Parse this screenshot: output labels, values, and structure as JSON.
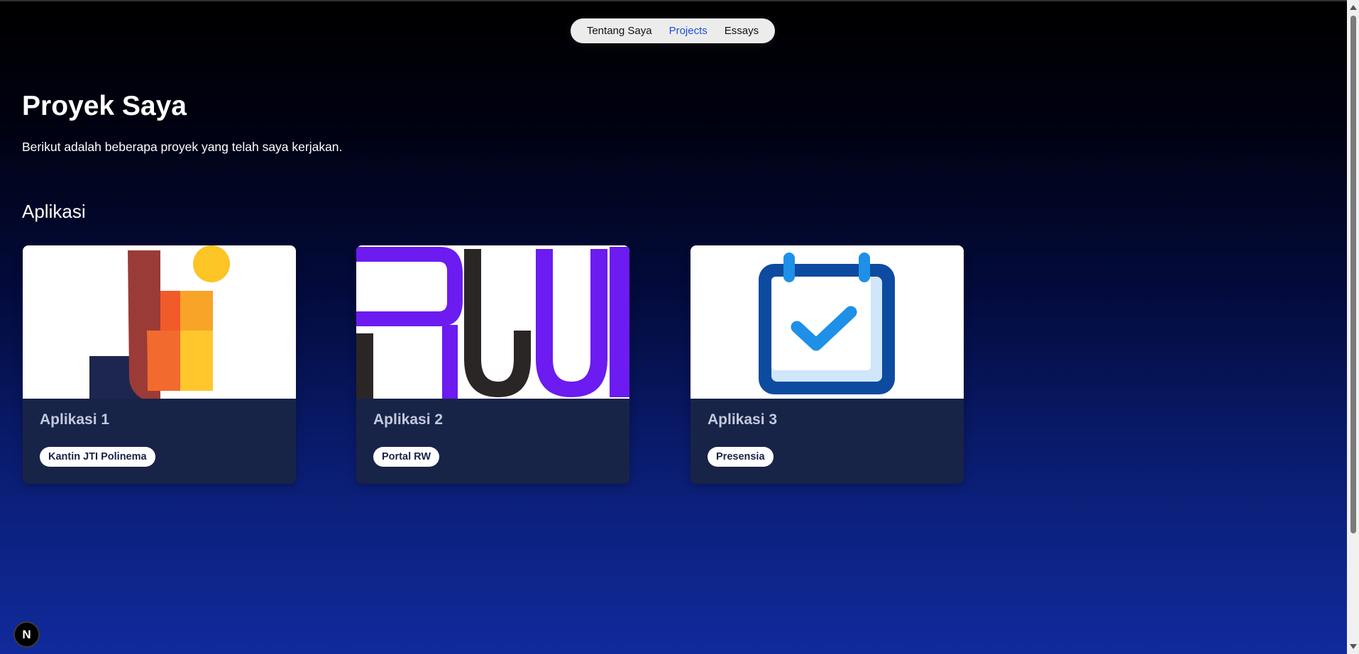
{
  "nav": {
    "items": [
      {
        "label": "Tentang Saya",
        "active": false
      },
      {
        "label": "Projects",
        "active": true
      },
      {
        "label": "Essays",
        "active": false
      }
    ],
    "active_color": "#1d4ed8"
  },
  "header": {
    "title": "Proyek Saya",
    "subtitle": "Berikut adalah beberapa proyek yang telah saya kerjakan."
  },
  "section": {
    "title": "Aplikasi"
  },
  "cards": [
    {
      "title": "Aplikasi 1",
      "tag": "Kantin JTI Polinema",
      "logo": "jti-logo"
    },
    {
      "title": "Aplikasi 2",
      "tag": "Portal RW",
      "logo": "rw-logo"
    },
    {
      "title": "Aplikasi 3",
      "tag": "Presensia",
      "logo": "calendar-check-icon"
    }
  ],
  "dev_badge": {
    "label": "N"
  }
}
